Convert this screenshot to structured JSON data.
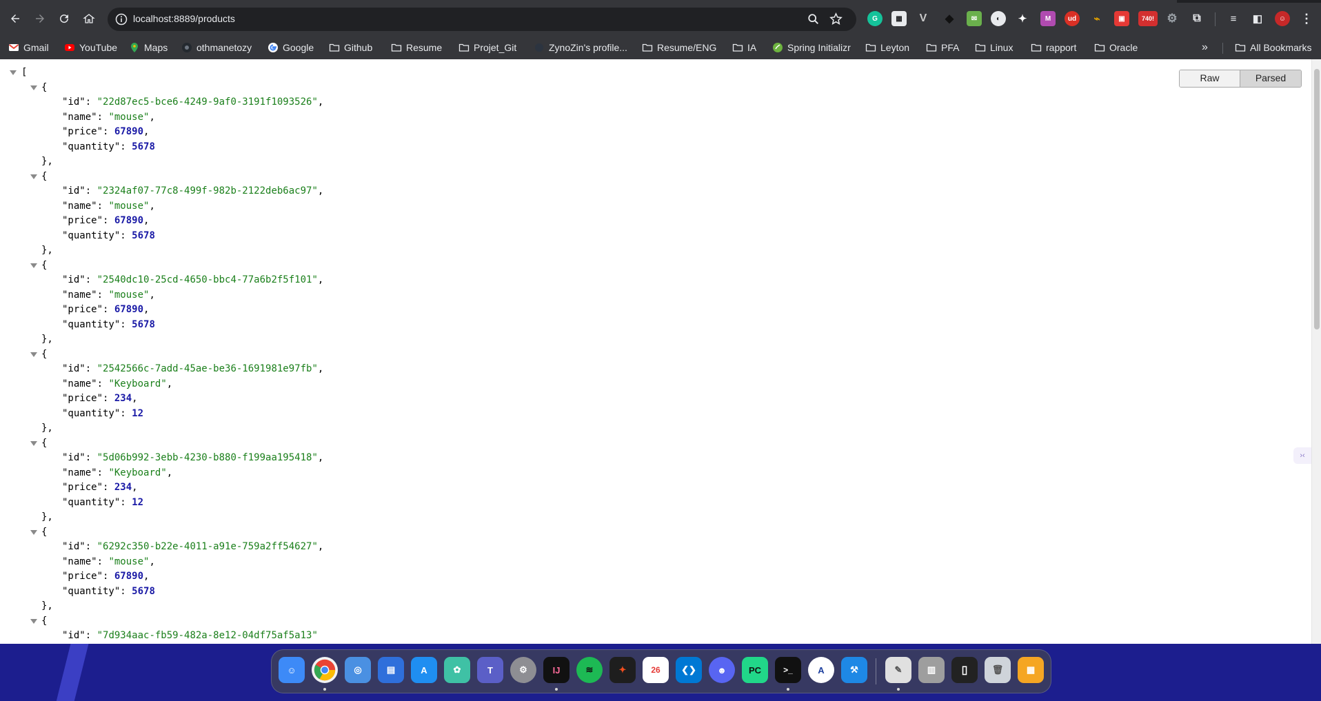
{
  "browser": {
    "url": "localhost:8889/products",
    "bookmarks": [
      {
        "label": "Gmail",
        "icon": "gmail-icon"
      },
      {
        "label": "YouTube",
        "icon": "youtube-icon"
      },
      {
        "label": "Maps",
        "icon": "maps-icon"
      },
      {
        "label": "othmanetozy",
        "icon": "github-icon"
      },
      {
        "label": "Google",
        "icon": "google-icon"
      },
      {
        "label": "Github",
        "icon": "folder-icon"
      },
      {
        "label": "Resume",
        "icon": "folder-icon"
      },
      {
        "label": "Projet_Git",
        "icon": "folder-icon"
      },
      {
        "label": "ZynoZin's profile...",
        "icon": "site-icon"
      },
      {
        "label": "Resume/ENG",
        "icon": "folder-icon"
      },
      {
        "label": "IA",
        "icon": "folder-icon"
      },
      {
        "label": "Spring Initializr",
        "icon": "spring-icon"
      },
      {
        "label": "Leyton",
        "icon": "folder-icon"
      },
      {
        "label": "PFA",
        "icon": "folder-icon"
      },
      {
        "label": "Linux",
        "icon": "folder-icon"
      },
      {
        "label": "rapport",
        "icon": "folder-icon"
      },
      {
        "label": "Oracle",
        "icon": "folder-icon"
      }
    ],
    "all_bookmarks_label": "All Bookmarks",
    "ext_badge": "740!"
  },
  "viewer": {
    "raw_label": "Raw",
    "parsed_label": "Parsed"
  },
  "json": {
    "open_bracket": "[",
    "products": [
      {
        "id": "22d87ec5-bce6-4249-9af0-3191f1093526",
        "name": "mouse",
        "price": "67890",
        "quantity": "5678"
      },
      {
        "id": "2324af07-77c8-499f-982b-2122deb6ac97",
        "name": "mouse",
        "price": "67890",
        "quantity": "5678"
      },
      {
        "id": "2540dc10-25cd-4650-bbc4-77a6b2f5f101",
        "name": "mouse",
        "price": "67890",
        "quantity": "5678"
      },
      {
        "id": "2542566c-7add-45ae-be36-1691981e97fb",
        "name": "Keyboard",
        "price": "234",
        "quantity": "12"
      },
      {
        "id": "5d06b992-3ebb-4230-b880-f199aa195418",
        "name": "Keyboard",
        "price": "234",
        "quantity": "12"
      },
      {
        "id": "6292c350-b22e-4011-a91e-759a2ff54627",
        "name": "mouse",
        "price": "67890",
        "quantity": "5678"
      },
      {
        "id": "7d934aac-fb59-482a-8e12-04df75af5a13"
      }
    ]
  },
  "dock": {
    "calendar_date": "26"
  },
  "colors": {
    "json_string": "#1a7f1a",
    "json_number": "#1a1aa6",
    "chrome_bg": "#35363a",
    "desktop_bg": "#1c1e8e"
  }
}
